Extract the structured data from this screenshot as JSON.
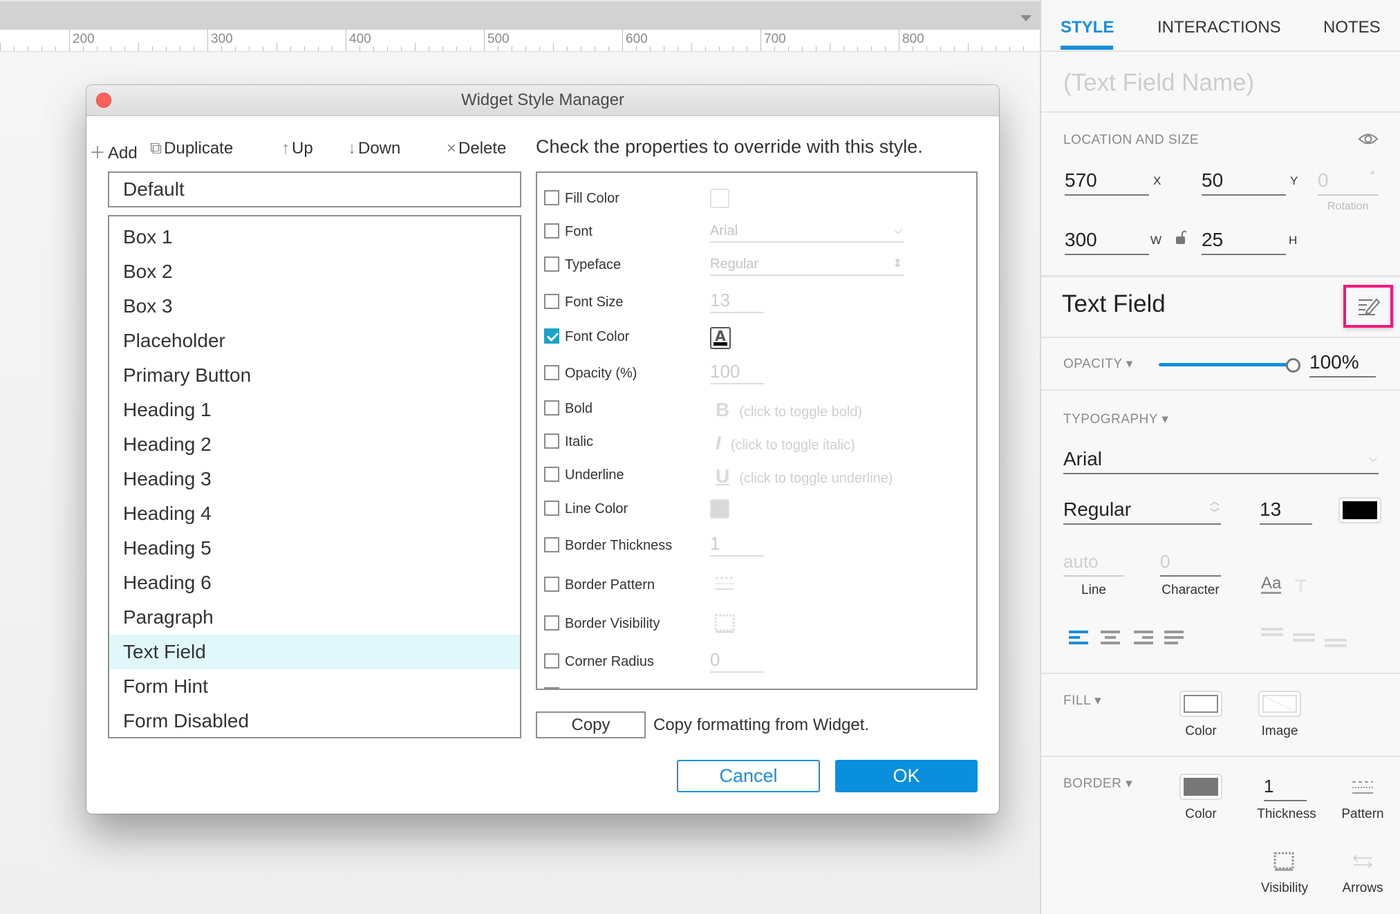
{
  "canvas": {
    "ruler_labels": [
      "200",
      "300",
      "400",
      "500",
      "600",
      "700",
      "800"
    ]
  },
  "dialog": {
    "title": "Widget Style Manager",
    "toolbar": {
      "add": "Add",
      "duplicate": "Duplicate",
      "up": "Up",
      "down": "Down",
      "delete": "Delete"
    },
    "default_style": "Default",
    "styles": [
      "Box 1",
      "Box 2",
      "Box 3",
      "Placeholder",
      "Primary Button",
      "Heading 1",
      "Heading 2",
      "Heading 3",
      "Heading 4",
      "Heading 5",
      "Heading 6",
      "Paragraph",
      "Text Field",
      "Form Hint",
      "Form Disabled"
    ],
    "selected_style": "Text Field",
    "instruction": "Check the properties to override with this style.",
    "properties": [
      {
        "label": "Fill Color",
        "checked": false,
        "control": "swatch",
        "value": ""
      },
      {
        "label": "Font",
        "checked": false,
        "control": "select",
        "value": "Arial"
      },
      {
        "label": "Typeface",
        "checked": false,
        "control": "spinner",
        "value": "Regular"
      },
      {
        "label": "Font Size",
        "checked": false,
        "control": "input",
        "value": "13"
      },
      {
        "label": "Font Color",
        "checked": true,
        "control": "font-color",
        "value": "A"
      },
      {
        "label": "Opacity (%)",
        "checked": false,
        "control": "input",
        "value": "100"
      },
      {
        "label": "Bold",
        "checked": false,
        "control": "toggle",
        "glyph": "B",
        "value": "(click to toggle bold)"
      },
      {
        "label": "Italic",
        "checked": false,
        "control": "toggle",
        "glyph": "I",
        "value": "(click to toggle italic)"
      },
      {
        "label": "Underline",
        "checked": false,
        "control": "toggle",
        "glyph": "U",
        "value": "(click to toggle underline)"
      },
      {
        "label": "Line Color",
        "checked": false,
        "control": "swatch-gray",
        "value": ""
      },
      {
        "label": "Border Thickness",
        "checked": false,
        "control": "input",
        "value": "1"
      },
      {
        "label": "Border Pattern",
        "checked": false,
        "control": "pattern",
        "value": ""
      },
      {
        "label": "Border Visibility",
        "checked": false,
        "control": "visibility",
        "value": ""
      },
      {
        "label": "Corner Radius",
        "checked": false,
        "control": "input",
        "value": "0"
      }
    ],
    "copy_button": "Copy",
    "copy_text": "Copy formatting from Widget.",
    "cancel": "Cancel",
    "ok": "OK"
  },
  "panel": {
    "tabs": [
      "STYLE",
      "INTERACTIONS",
      "NOTES"
    ],
    "active_tab": "STYLE",
    "widget_name_placeholder": "(Text Field Name)",
    "location": {
      "heading": "LOCATION AND SIZE",
      "x": "570",
      "x_label": "X",
      "y": "50",
      "y_label": "Y",
      "rotation": "0",
      "rotation_unit": "°",
      "rotation_label": "Rotation",
      "w": "300",
      "w_label": "W",
      "h": "25",
      "h_label": "H"
    },
    "widget_type": "Text Field",
    "opacity": {
      "heading": "OPACITY ▾",
      "value": "100%",
      "fraction": 1.0
    },
    "typography": {
      "heading": "TYPOGRAPHY ▾",
      "font": "Arial",
      "typeface": "Regular",
      "size": "13",
      "color": "#000000",
      "line": "auto",
      "line_label": "Line",
      "character": "0",
      "character_label": "Character",
      "case_icon": "Aa"
    },
    "fill": {
      "heading": "FILL ▾",
      "color_label": "Color",
      "image_label": "Image"
    },
    "border": {
      "heading": "BORDER ▾",
      "color_label": "Color",
      "color": "#777777",
      "thickness": "1",
      "thickness_label": "Thickness",
      "pattern_label": "Pattern",
      "visibility_label": "Visibility",
      "arrows_label": "Arrows"
    }
  },
  "colors": {
    "accent": "#0a8fdc",
    "selection": "#e0f8fa",
    "highlight": "#f0197d",
    "close": "#fc605b"
  }
}
